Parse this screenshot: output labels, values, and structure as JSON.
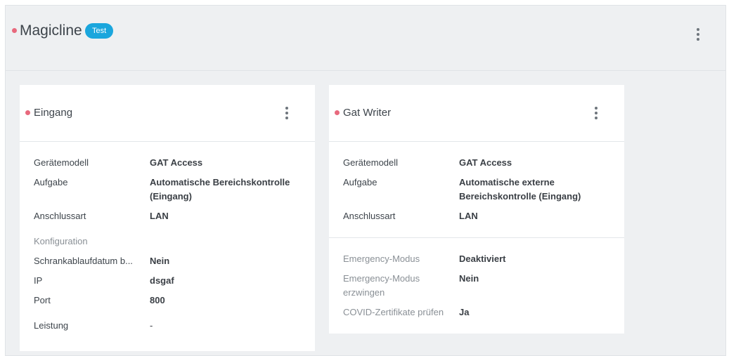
{
  "header": {
    "title": "Magicline",
    "badge": "Test",
    "status_color": "#e8697d"
  },
  "cards": [
    {
      "title": "Eingang",
      "rows": [
        {
          "label": "Gerätemodell",
          "value": "GAT Access"
        },
        {
          "label": "Aufgabe",
          "value": "Automatische Bereichskontrolle (Eingang)"
        },
        {
          "label": "Anschlussart",
          "value": "LAN"
        }
      ],
      "section_label": "Konfiguration",
      "config_rows": [
        {
          "label": "Schrankablaufdatum b...",
          "value": "Nein"
        },
        {
          "label": "IP",
          "value": "dsgaf"
        },
        {
          "label": "Port",
          "value": "800"
        },
        {
          "label": "Leistung",
          "value": "-"
        }
      ]
    },
    {
      "title": "Gat Writer",
      "rows": [
        {
          "label": "Gerätemodell",
          "value": "GAT Access"
        },
        {
          "label": "Aufgabe",
          "value": "Automatische externe Bereichskontrolle (Eingang)"
        },
        {
          "label": "Anschlussart",
          "value": "LAN"
        }
      ],
      "extra_rows": [
        {
          "label": "Emergency-Modus",
          "value": "Deaktiviert"
        },
        {
          "label": "Emergency-Modus erzwingen",
          "value": "Nein"
        },
        {
          "label": "COVID-Zertifikate prüfen",
          "value": "Ja"
        }
      ]
    }
  ]
}
